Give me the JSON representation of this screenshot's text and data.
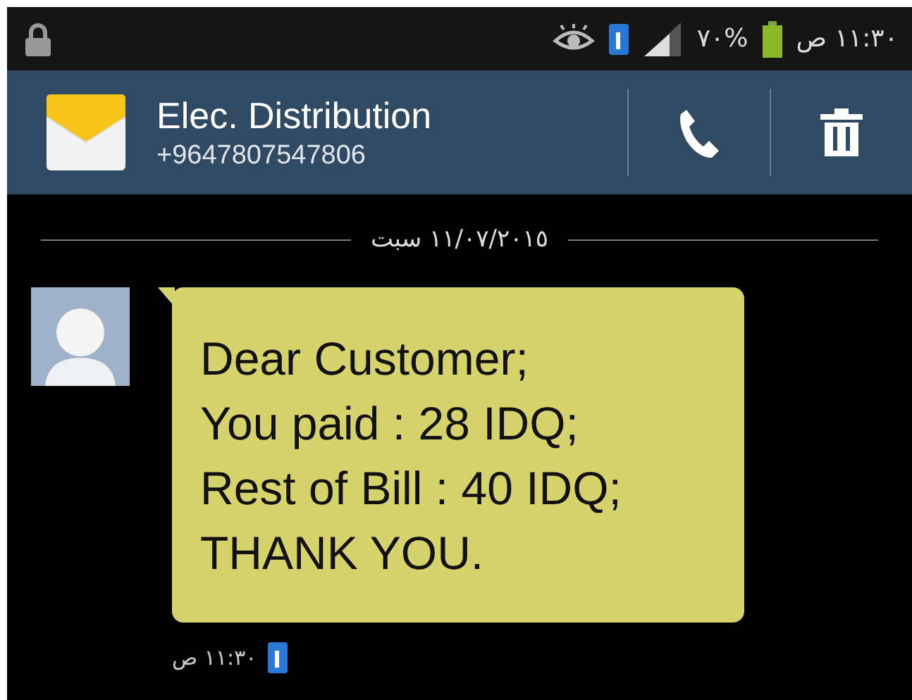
{
  "status_bar": {
    "battery": "٧٠%",
    "time": "١١:٣٠ ص"
  },
  "header": {
    "name": "Elec. Distribution",
    "number": "+9647807547806"
  },
  "date_divider": "١١/٠٧/٢٠١٥ سبت",
  "messages": [
    {
      "text": "Dear Customer;\nYou paid : 28 IDQ;\nRest of Bill : 40 IDQ;\nTHANK YOU.",
      "time": "١١:٣٠ ص"
    }
  ]
}
